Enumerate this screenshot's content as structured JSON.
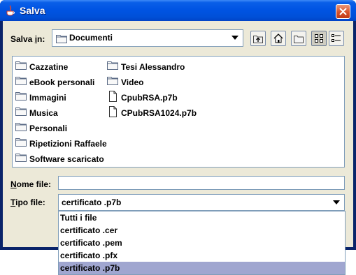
{
  "window": {
    "title": "Salva",
    "title_bar_color": "#0054e3",
    "client_bg": "#ece9d8"
  },
  "save_in": {
    "label_prefix": "Salva ",
    "label_accel": "i",
    "label_suffix": "n:",
    "folder": "Documenti"
  },
  "toolbar": {
    "icons": [
      "up-folder-icon",
      "home-icon",
      "new-folder-icon",
      "list-view-icon",
      "details-view-icon"
    ]
  },
  "files": {
    "column1": [
      {
        "name": "Cazzatine",
        "icon": "folder-icon"
      },
      {
        "name": "eBook personali",
        "icon": "folder-icon"
      },
      {
        "name": "Immagini",
        "icon": "folder-icon"
      },
      {
        "name": "Musica",
        "icon": "folder-icon"
      },
      {
        "name": "Personali",
        "icon": "folder-icon"
      },
      {
        "name": "Ripetizioni Raffaele",
        "icon": "folder-icon"
      },
      {
        "name": "Software scaricato",
        "icon": "folder-icon"
      }
    ],
    "column2": [
      {
        "name": "Tesi Alessandro",
        "icon": "folder-icon"
      },
      {
        "name": "Video",
        "icon": "folder-icon"
      },
      {
        "name": "CpubRSA.p7b",
        "icon": "file-icon"
      },
      {
        "name": "CPubRSA1024.p7b",
        "icon": "file-icon"
      }
    ]
  },
  "file_name": {
    "label_accel": "N",
    "label_rest": "ome file:",
    "value": ""
  },
  "file_type": {
    "label_accel": "T",
    "label_rest": "ipo file:",
    "selected": "certificato .p7b",
    "options": [
      "Tutti i file",
      "certificato .cer",
      "certificato .pem",
      "certificato .pfx",
      "certificato .p7b"
    ],
    "highlight_color": "#a0a6d0"
  }
}
